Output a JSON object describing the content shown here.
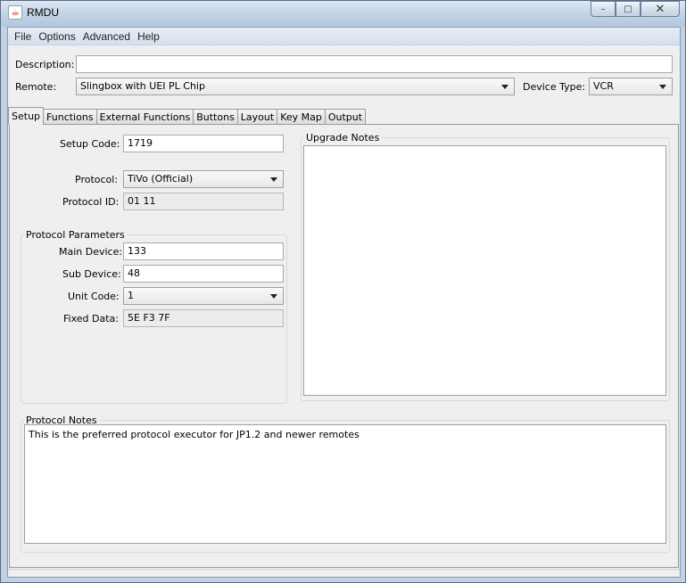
{
  "window": {
    "title": "RMDU",
    "minimize_glyph": "–",
    "maximize_glyph": "□",
    "close_glyph": "✕"
  },
  "menu": [
    "File",
    "Options",
    "Advanced",
    "Help"
  ],
  "description": {
    "label": "Description:",
    "value": ""
  },
  "remote": {
    "label": "Remote:",
    "value": "Slingbox with UEI PL Chip"
  },
  "device_type": {
    "label": "Device Type:",
    "value": "VCR"
  },
  "tabs": [
    "Setup",
    "Functions",
    "External Functions",
    "Buttons",
    "Layout",
    "Key Map",
    "Output"
  ],
  "active_tab": "Setup",
  "setup": {
    "setup_code": {
      "label": "Setup Code:",
      "value": "1719"
    },
    "protocol": {
      "label": "Protocol:",
      "value": "TiVo (Official)"
    },
    "protocol_id": {
      "label": "Protocol ID:",
      "value": "01 11"
    },
    "parameters_title": "Protocol Parameters",
    "main_device": {
      "label": "Main Device:",
      "value": "133"
    },
    "sub_device": {
      "label": "Sub Device:",
      "value": "48"
    },
    "unit_code": {
      "label": "Unit Code:",
      "value": "1"
    },
    "fixed_data": {
      "label": "Fixed Data:",
      "value": "5E F3 7F"
    },
    "upgrade_notes": {
      "title": "Upgrade Notes",
      "value": ""
    },
    "protocol_notes": {
      "title": "Protocol Notes",
      "value": "This is the preferred protocol executor for JP1.2 and newer remotes"
    }
  },
  "icons": {
    "app": "java-cup-icon",
    "combo": "chevron-down-icon"
  }
}
